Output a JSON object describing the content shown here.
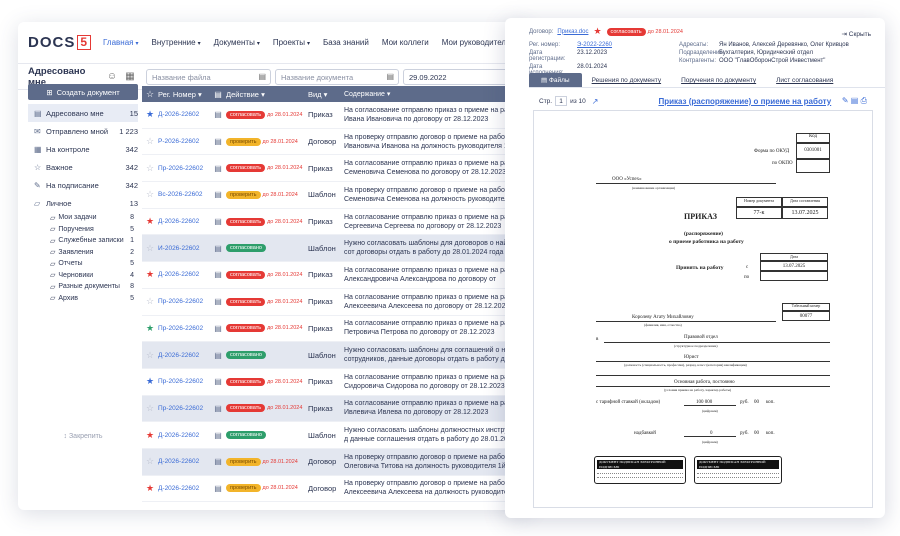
{
  "nav": {
    "logo_text": "DOCS",
    "logo_num": "5",
    "items": [
      {
        "label": "Главная",
        "active": true
      },
      {
        "label": "Внутренние"
      },
      {
        "label": "Документы"
      },
      {
        "label": "Проекты"
      },
      {
        "label": "База знаний"
      },
      {
        "label": "Мои коллеги"
      },
      {
        "label": "Мои руководители"
      },
      {
        "label": "Уче"
      }
    ]
  },
  "subbar": {
    "title": "Адресовано мне",
    "file_placeholder": "Название файла",
    "doc_placeholder": "Название документа",
    "date": "29.09.2022"
  },
  "sidebar": {
    "create_label": "Создать документ",
    "items": [
      {
        "label": "Адресовано мне",
        "count": "15",
        "icon": "inbox-icon"
      },
      {
        "label": "Отправлено мной",
        "count": "1 223",
        "icon": "mail-icon"
      },
      {
        "label": "На контроле",
        "count": "342",
        "icon": "calendar-icon"
      },
      {
        "label": "Важное",
        "count": "342",
        "icon": "star-icon"
      },
      {
        "label": "На подписание",
        "count": "342",
        "icon": "pen-icon"
      },
      {
        "label": "Личное",
        "count": "13",
        "icon": "folder-icon"
      }
    ],
    "sub": [
      {
        "label": "Мои задачи",
        "count": "8"
      },
      {
        "label": "Поручения",
        "count": "5"
      },
      {
        "label": "Служебные записки",
        "count": "1"
      },
      {
        "label": "Заявления",
        "count": "2"
      },
      {
        "label": "Отчеты",
        "count": "5"
      },
      {
        "label": "Черновики",
        "count": "4"
      },
      {
        "label": "Разные документы",
        "count": "8"
      },
      {
        "label": "Архив",
        "count": "5"
      }
    ],
    "pin_label": "Закрепить"
  },
  "table": {
    "headers": {
      "num": "Рег. Номер",
      "action": "Действие",
      "kind": "Вид",
      "content": "Содержание"
    },
    "rows": [
      {
        "star": "y",
        "num": "Д-2026-22602",
        "badge": "согласовать",
        "bc": "sog",
        "due": "до 28.01.2024",
        "kind": "Приказ",
        "text": "На согласование отправлю приказ о приеме на работу Ивана Ивановича по договору от 28.12.2023"
      },
      {
        "star": "o",
        "num": "Р-2026-22602",
        "badge": "проверить",
        "bc": "prov",
        "due": "до 28.01.2024",
        "kind": "Договор",
        "text": "На проверку отправлю договор о приеме на работу сотр Ивановича Иванова на должность руководителя 1й лин"
      },
      {
        "star": "o",
        "num": "Пр-2026-22602",
        "badge": "согласовать",
        "bc": "sog",
        "due": "до 28.01.2024",
        "kind": "Приказ",
        "text": "На согласование отправлю приказ о приеме на работу Семеновича Семенова по договору от 28.12.2023"
      },
      {
        "star": "o",
        "num": "Вс-2026-22602",
        "badge": "проверить",
        "bc": "prov",
        "due": "до 28.01.2024",
        "kind": "Шаблон",
        "text": "На проверку отправлю договор о приеме на работу сотр Семеновича Семенова на должность руководителя 3й ли"
      },
      {
        "star": "r",
        "num": "Д-2026-22602",
        "badge": "согласовать",
        "bc": "sog",
        "due": "до 28.01.2024",
        "kind": "Приказ",
        "text": "На согласование отправлю приказ о приеме на работу Сергеевича Сергеева по договору от 28.12.2023"
      },
      {
        "star": "o",
        "num": "И-2026-22602",
        "badge": "согласовано",
        "bc": "ok",
        "due": "",
        "kind": "Шаблон",
        "text": "Нужно согласовать шаблоны для договоров о найме сот договоры отдать в работу до 28.01.2024 года",
        "shade": true
      },
      {
        "star": "r",
        "num": "Д-2026-22602",
        "badge": "согласовать",
        "bc": "sog",
        "due": "до 28.01.2024",
        "kind": "Приказ",
        "text": "На согласование отправлю приказ о приеме на работу Александровича Александрова по договору от 28.12.2023"
      },
      {
        "star": "o",
        "num": "Пр-2026-22602",
        "badge": "согласовать",
        "bc": "sog",
        "due": "до 28.01.2024",
        "kind": "Приказ",
        "text": "На согласование отправлю приказ о приеме на работу Алексеевича Алексеева по договору от 28.12.2023"
      },
      {
        "star": "g",
        "num": "Пр-2026-22602",
        "badge": "согласовать",
        "bc": "sog",
        "due": "до 28.01.2024",
        "kind": "Приказ",
        "text": "На согласование отправлю приказ о приеме на работу Петровича Петрова по договору от 28.12.2023"
      },
      {
        "star": "o",
        "num": "Д-2026-22602",
        "badge": "согласовано",
        "bc": "ok",
        "due": "",
        "kind": "Шаблон",
        "text": "Нужно согласовать шаблоны для соглашений о неразгл сотрудников, данные договоры отдать в работу до 28",
        "shade": true
      },
      {
        "star": "y",
        "num": "Пр-2026-22602",
        "badge": "согласовать",
        "bc": "sog",
        "due": "до 28.01.2024",
        "kind": "Приказ",
        "text": "На согласование отправлю приказ о приеме на работу Сидоровича Сидорова по договору от 28.12.2023"
      },
      {
        "star": "o",
        "num": "Пр-2026-22602",
        "badge": "согласовать",
        "bc": "sog",
        "due": "до 28.01.2024",
        "kind": "Приказ",
        "text": "На согласование отправлю приказ о приеме на работу Ивлевича Ивлева по договору от 28.12.2023",
        "shade": true
      },
      {
        "star": "r",
        "num": "Д-2026-22602",
        "badge": "согласовано",
        "bc": "ok",
        "due": "",
        "kind": "Шаблон",
        "text": "Нужно согласовать шаблоны должностных инструкций д данные соглашения отдать в работу до 28.01.2024 года"
      },
      {
        "star": "o",
        "num": "Д-2026-22602",
        "badge": "проверить",
        "bc": "prov",
        "due": "до 28.01.2024",
        "kind": "Договор",
        "text": "На проверку отправлю договор о приеме на работу сотр Олеговича Титова на должность руководителя 1й лин",
        "shade": true
      },
      {
        "star": "r",
        "num": "Д-2026-22602",
        "badge": "проверить",
        "bc": "prov",
        "due": "до 28.01.2024",
        "kind": "Договор",
        "text": "На проверку отправлю договор о приеме на работу сотр Алексеевича Алексеева на должность руководителя 1й"
      }
    ]
  },
  "doc": {
    "contract_label": "Договор:",
    "contract_link": "Приказ.doc",
    "badge": "согласовать",
    "due": "до 28.01.2024",
    "close": "Скрыть",
    "reg_k": "Рег. номер:",
    "reg_v": "Э-2022-2260",
    "regdate_k": "Дата регистрации:",
    "regdate_v": "23.12.2023",
    "exec_k": "Дата исполнения:",
    "exec_v": "28.01.2024",
    "addr_k": "Адресаты:",
    "addr_v": "Ян Иванов, Алексей Деревянко, Олег Кривцов",
    "dept_k": "Подразделение:",
    "dept_v": "Бухгалтерия, Юридический отдел",
    "contr_k": "Контрагенты:",
    "contr_v": "ООО \"ГлавОборонСтрой Инвестмент\"",
    "tabs": [
      "Файлы",
      "Решения по документу",
      "Поручения по документу",
      "Лист согласования"
    ],
    "page_label": "Стр.",
    "page": "1",
    "page_of": "из 10",
    "title": "Приказ (распоряжение) о приеме на работу"
  },
  "paper": {
    "kod": "Код",
    "okud_label": "Форма по ОКУД",
    "okud": "0301001",
    "okpo_label": "по ОКПО",
    "org": "ООО «Успех»",
    "org_caption": "(наименование организации)",
    "num_h": "Номер документа",
    "date_h": "Дата составления",
    "num_v": "77-к",
    "date_v": "13.07.2025",
    "prikaz": "ПРИКАЗ",
    "rasp": "(распоряжение)",
    "about": "о приеме работника на работу",
    "accept": "Принять на работу",
    "date_label": "Дата",
    "from": "с",
    "from_date": "13.07.2025",
    "to": "по",
    "tab_label": "Табельный номер",
    "tab_num": "00077",
    "person": "Королеву Агату Михайловну",
    "person_caption": "(фамилия, имя, отчество)",
    "in": "в",
    "dept": "Правовой отдел",
    "dept_caption": "(структурное подразделение)",
    "role": "Юрист",
    "role_caption": "(должность (специальность, профессия), разряд, класс (категория) квалификации)",
    "cond": "Основная работа, постоянно",
    "cond_caption": "(условия приема на работу, характер работы)",
    "salary_label": "с тарифной ставкой (окладом)",
    "salary": "100 000",
    "rub": "руб.",
    "kop": "00",
    "kop_label": "коп.",
    "digits": "(цифрами)",
    "bonus_label": "надбавкой",
    "bonus": "0",
    "bonus_kop": "00",
    "sig_head": "ДОКУМЕНТ ПОДПИСАН ЭЛЕКТРОННОЙ ПОДПИСЬЮ"
  }
}
